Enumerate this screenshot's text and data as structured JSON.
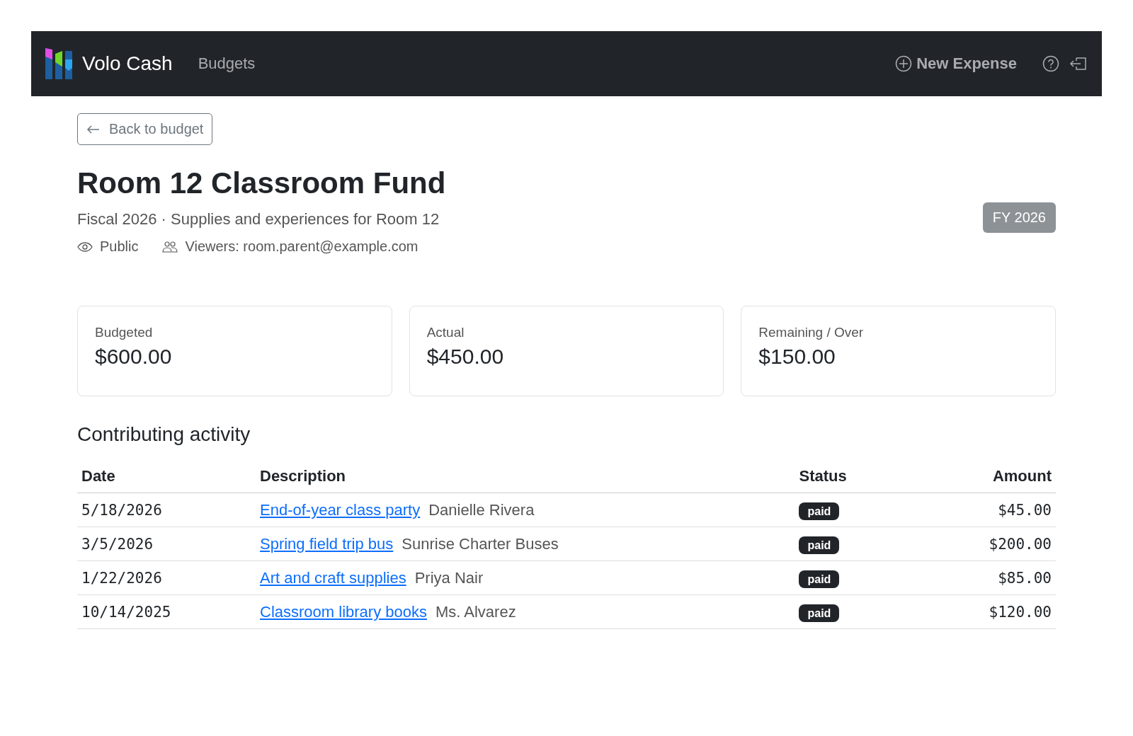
{
  "navbar": {
    "brand": "Volo Cash",
    "links": [
      {
        "label": "Budgets"
      }
    ],
    "new_expense": "New Expense"
  },
  "back_button": "Back to budget",
  "budget": {
    "title": "Room 12 Classroom Fund",
    "subtitle": "Fiscal 2026 · Supplies and experiences for Room 12",
    "visibility": "Public",
    "viewers": "Viewers: room.parent@example.com",
    "badge": "FY 2026"
  },
  "summary": [
    {
      "label": "Budgeted",
      "value": "$600.00"
    },
    {
      "label": "Actual",
      "value": "$450.00"
    },
    {
      "label": "Remaining / Over",
      "value": "$150.00"
    }
  ],
  "activity": {
    "title": "Contributing activity",
    "columns": [
      "Date",
      "Description",
      "Status",
      "Amount"
    ],
    "rows": [
      {
        "date": "5/18/2026",
        "link": "End-of-year class party",
        "payee": "Danielle Rivera",
        "status": "paid",
        "amount": "$45.00"
      },
      {
        "date": "3/5/2026",
        "link": "Spring field trip bus",
        "payee": "Sunrise Charter Buses",
        "status": "paid",
        "amount": "$200.00"
      },
      {
        "date": "1/22/2026",
        "link": "Art and craft supplies",
        "payee": "Priya Nair",
        "status": "paid",
        "amount": "$85.00"
      },
      {
        "date": "10/14/2025",
        "link": "Classroom library books",
        "payee": "Ms. Alvarez",
        "status": "paid",
        "amount": "$120.00"
      }
    ]
  }
}
